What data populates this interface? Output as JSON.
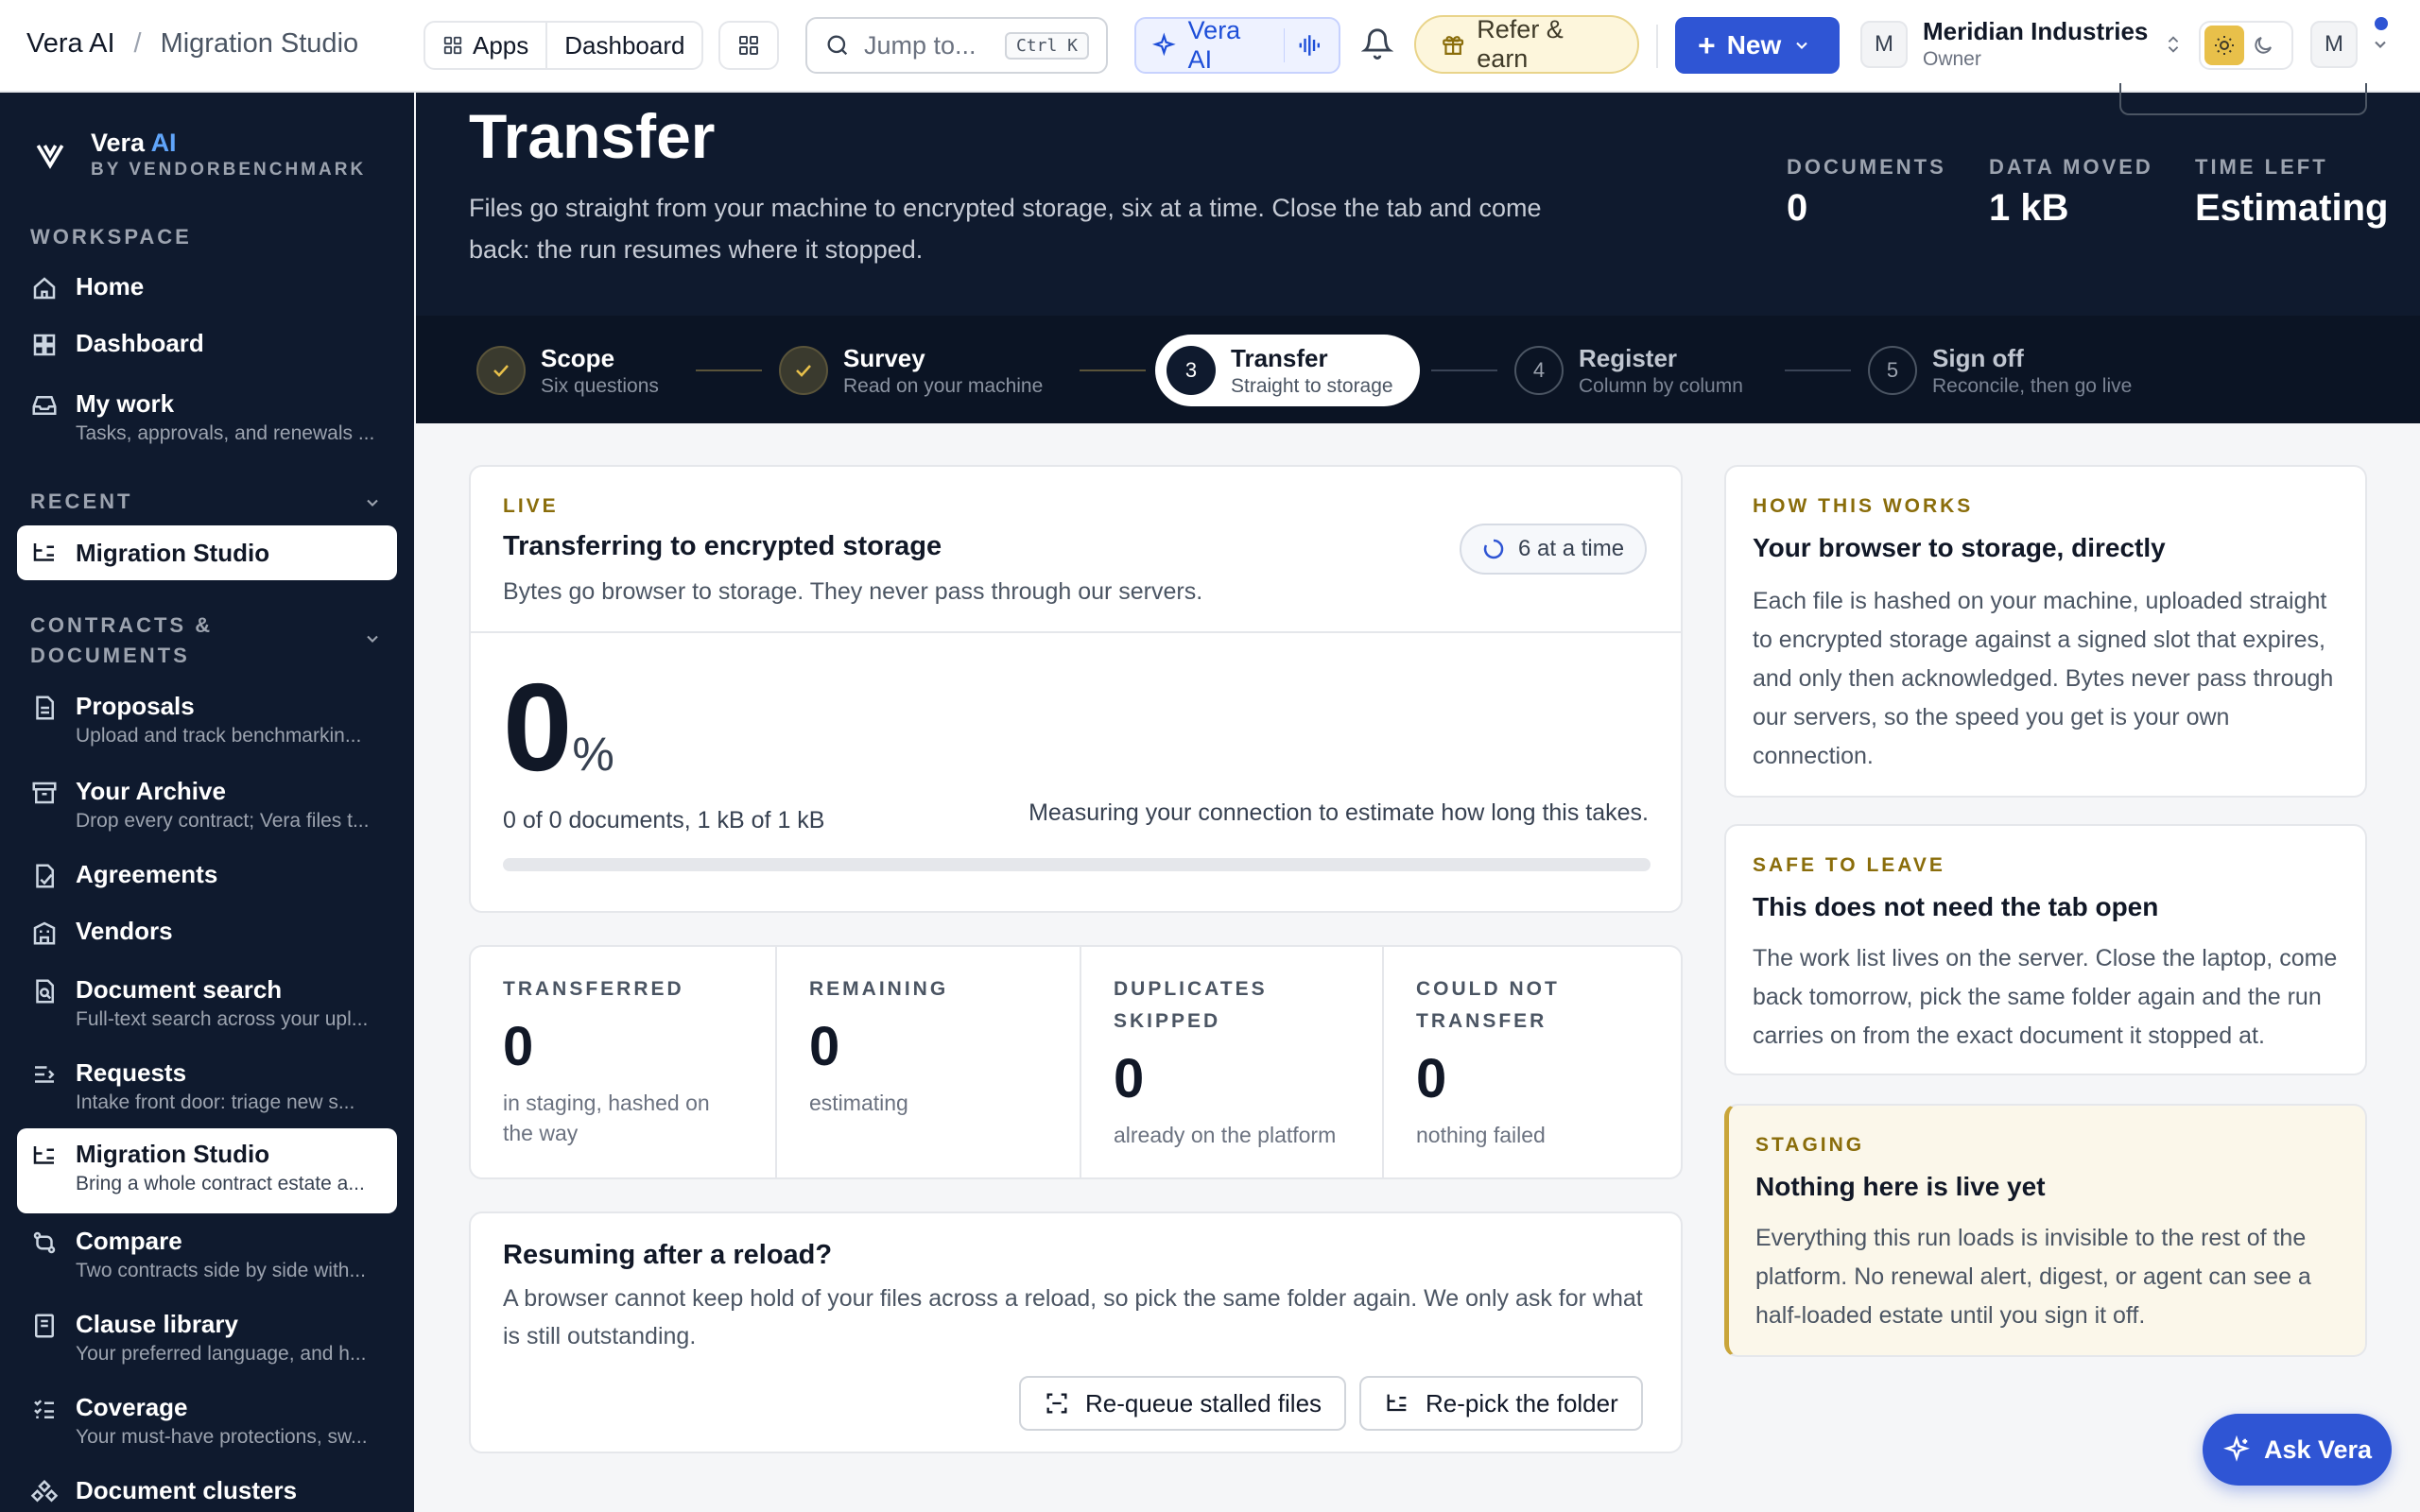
{
  "breadcrumb": {
    "root": "Vera AI",
    "separator": "/",
    "current": "Migration Studio"
  },
  "topbar": {
    "apps": "Apps",
    "dashboard": "Dashboard",
    "search_placeholder": "Jump to...",
    "search_shortcut": "Ctrl K",
    "vera_ai": "Vera AI",
    "refer": "Refer & earn",
    "new": "New",
    "org_avatar": "M",
    "org_name": "Meridian Industries",
    "org_role": "Owner",
    "user_avatar": "M"
  },
  "sidebar": {
    "brand_name": "Vera",
    "brand_ai": "AI",
    "brand_by": "BY VENDORBENCHMARK",
    "workspace_label": "WORKSPACE",
    "recent_label": "RECENT",
    "contracts_label_1": "CONTRACTS &",
    "contracts_label_2": "DOCUMENTS",
    "items": [
      {
        "label": "Home"
      },
      {
        "label": "Dashboard"
      },
      {
        "label": "My work",
        "sub": "Tasks, approvals, and renewals ..."
      },
      {
        "label": "Migration Studio"
      },
      {
        "label": "Proposals",
        "sub": "Upload and track benchmarkin..."
      },
      {
        "label": "Your Archive",
        "sub": "Drop every contract; Vera files t..."
      },
      {
        "label": "Agreements"
      },
      {
        "label": "Vendors"
      },
      {
        "label": "Document search",
        "sub": "Full-text search across your upl..."
      },
      {
        "label": "Requests",
        "sub": "Intake front door: triage new s..."
      },
      {
        "label": "Migration Studio",
        "sub": "Bring a whole contract estate a..."
      },
      {
        "label": "Compare",
        "sub": "Two contracts side by side with..."
      },
      {
        "label": "Clause library",
        "sub": "Your preferred language, and h..."
      },
      {
        "label": "Coverage",
        "sub": "Your must-have protections, sw..."
      },
      {
        "label": "Document clusters"
      }
    ]
  },
  "hero": {
    "title": "Transfer",
    "description": "Files go straight from your machine to encrypted storage, six at a time. Close the tab and come back: the run resumes where it stopped.",
    "metrics": [
      {
        "label": "DOCUMENTS",
        "value": "0"
      },
      {
        "label": "DATA MOVED",
        "value": "1 kB"
      },
      {
        "label": "TIME LEFT",
        "value": "Estimating"
      }
    ]
  },
  "steps": [
    {
      "num": "1",
      "title": "Scope",
      "sub": "Six questions",
      "state": "done"
    },
    {
      "num": "2",
      "title": "Survey",
      "sub": "Read on your machine",
      "state": "done"
    },
    {
      "num": "3",
      "title": "Transfer",
      "sub": "Straight to storage",
      "state": "current"
    },
    {
      "num": "4",
      "title": "Register",
      "sub": "Column by column",
      "state": "todo"
    },
    {
      "num": "5",
      "title": "Sign off",
      "sub": "Reconcile, then go live",
      "state": "todo"
    }
  ],
  "transfer_card": {
    "eyebrow": "LIVE",
    "title": "Transferring to encrypted storage",
    "subtitle": "Bytes go browser to storage. They never pass through our servers.",
    "concurrency": "6 at a time",
    "percent": "0",
    "percent_sign": "%",
    "progress_fraction": 0,
    "summary": "0 of 0 documents, 1 kB of 1 kB",
    "estimate_note": "Measuring your connection to estimate how long this takes."
  },
  "stats": [
    {
      "label": "TRANSFERRED",
      "value": "0",
      "desc": "in staging, hashed on the way"
    },
    {
      "label": "REMAINING",
      "value": "0",
      "desc": "estimating"
    },
    {
      "label": "DUPLICATES SKIPPED",
      "value": "0",
      "desc": "already on the platform"
    },
    {
      "label": "COULD NOT TRANSFER",
      "value": "0",
      "desc": "nothing failed"
    }
  ],
  "resume_card": {
    "title": "Resuming after a reload?",
    "text": "A browser cannot keep hold of your files across a reload, so pick the same folder again. We only ask for what is still outstanding.",
    "requeue": "Re-queue stalled files",
    "repick": "Re-pick the folder"
  },
  "info_cards": [
    {
      "eyebrow": "HOW THIS WORKS",
      "title": "Your browser to storage, directly",
      "text": "Each file is hashed on your machine, uploaded straight to encrypted storage against a signed slot that expires, and only then acknowledged. Bytes never pass through our servers, so the speed you get is your own connection."
    },
    {
      "eyebrow": "SAFE TO LEAVE",
      "title": "This does not need the tab open",
      "text": "The work list lives on the server. Close the laptop, come back tomorrow, pick the same folder again and the run carries on from the exact document it stopped at."
    },
    {
      "eyebrow": "STAGING",
      "title": "Nothing here is live yet",
      "text": "Everything this run loads is invisible to the rest of the platform. No renewal alert, digest, or agent can see a half-loaded estate until you sign it off."
    }
  ],
  "ask_vera": "Ask Vera",
  "colors": {
    "accent": "#2f55d4",
    "navy": "#0f1a2e",
    "gold": "#8a6d0b"
  }
}
